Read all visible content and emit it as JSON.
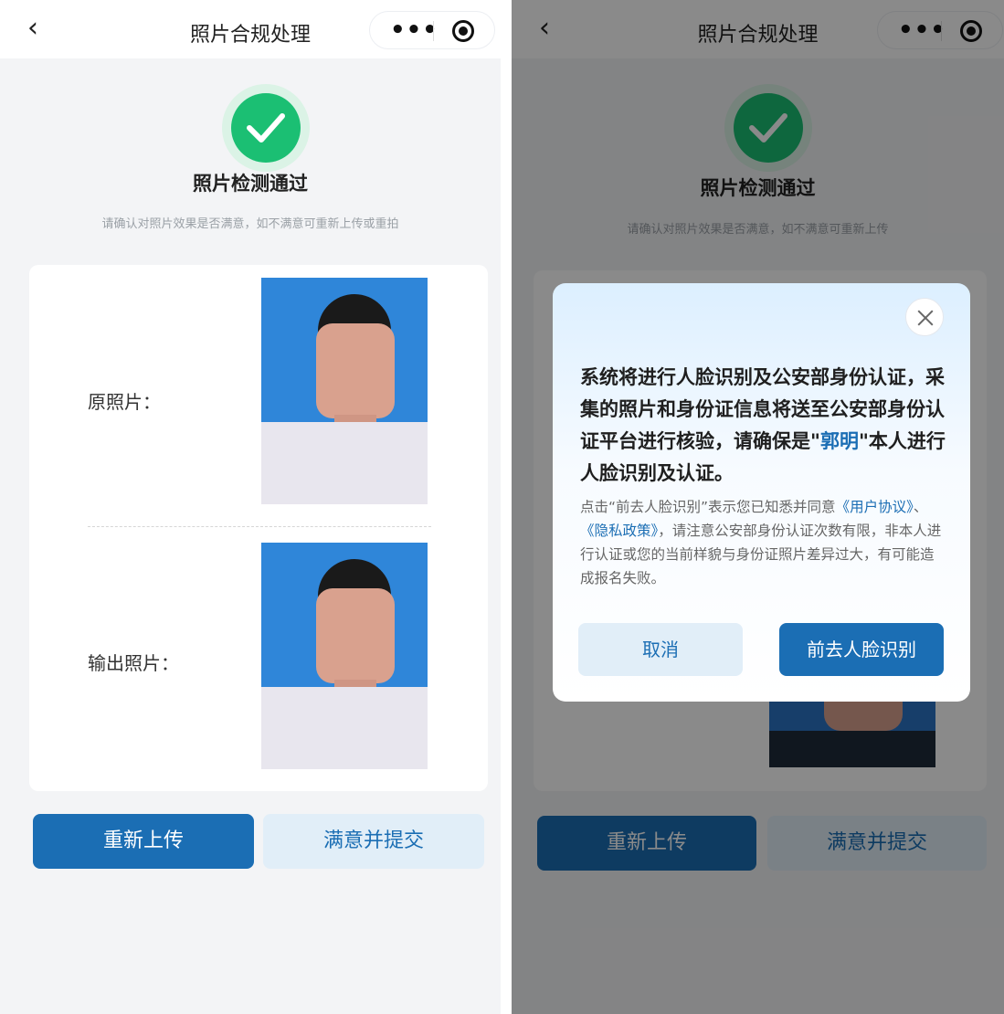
{
  "nav": {
    "back_glyph": "‹",
    "title": "照片合规处理",
    "more_glyph": "•••",
    "icons": [
      "chevron-left-icon",
      "more-icon",
      "target-icon"
    ]
  },
  "status": {
    "title": "照片检测通过",
    "hint_left": "请确认对照片效果是否满意，如不满意可重新上传或重拍",
    "hint_right": "请确认对照片效果是否满意，如不满意可重新上传"
  },
  "photos": {
    "original_label": "原照片：",
    "output_label": "输出照片："
  },
  "buttons": {
    "reupload": "重新上传",
    "submit": "满意并提交"
  },
  "modal": {
    "heading_pre": "系统将进行人脸识别及公安部身份认证，采集的照片和身份证信息将送至公安部身份认证平台进行核验，请确保是\"",
    "heading_name": "郭明",
    "heading_post": "\"本人进行人脸识别及认证。",
    "body_pre": "点击“前去人脸识别”表示您已知悉并同意",
    "link_agreement": "《用户协议》",
    "body_sep": "、",
    "link_privacy": "《隐私政策》",
    "body_post": "，请注意公安部身份认证次数有限，非本人进行认证或您的当前样貌与身份证照片差异过大，有可能造成报名失败。",
    "cancel": "取消",
    "confirm": "前去人脸识别"
  },
  "colors": {
    "primary": "#1b6eb4",
    "success": "#1bbf73",
    "photo_bg": "#2f86d9"
  }
}
